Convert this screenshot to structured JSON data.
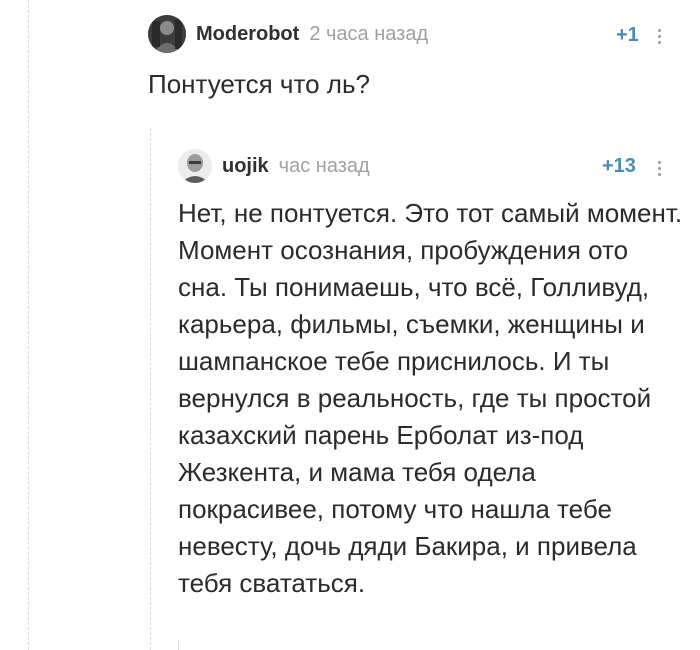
{
  "comment_1": {
    "author": "Moderobot",
    "time": "2 часа назад",
    "rating": "+1",
    "text": "Понтуется что ль?"
  },
  "comment_2": {
    "author": "uojik",
    "time": "час назад",
    "rating": "+13",
    "text": "Нет, не понтуется. Это тот самый момент. Момент осознания, пробуждения ото сна. Ты понимаешь, что всё, Голливуд, карьера, фильмы, съемки, женщины и шампанское тебе приснилось. И ты вернулся в реальность, где ты простой казахский парень Ерболат из-под Жезкента, и мама тебя одела покрасивее, потому что нашла тебе невесту, дочь дяди Бакира, и привела тебя свататься."
  },
  "icons": {
    "avatar_1": "avatar-moderobot-icon",
    "avatar_2": "avatar-uojik-icon",
    "more": "vertical-dots-icon"
  },
  "colors": {
    "rating": "#4a8cb8",
    "time": "#a0a0a0",
    "thread_line": "#dcdcdc"
  }
}
